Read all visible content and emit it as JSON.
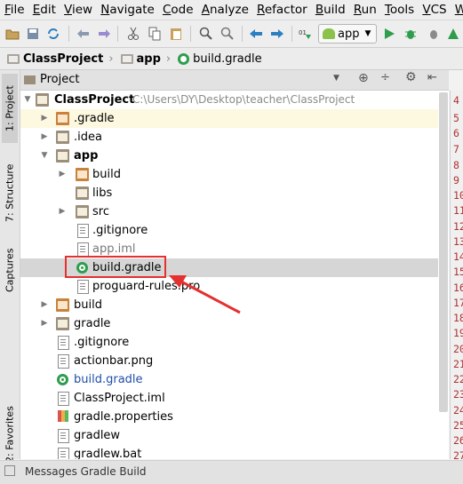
{
  "menu": [
    "File",
    "Edit",
    "View",
    "Navigate",
    "Code",
    "Analyze",
    "Refactor",
    "Build",
    "Run",
    "Tools",
    "VCS",
    "Windo"
  ],
  "toolbar": {
    "run_config": "app"
  },
  "breadcrumb": [
    "ClassProject",
    "app",
    "build.gradle"
  ],
  "panel": {
    "title": "Project"
  },
  "side_tabs": {
    "project": "1: Project",
    "structure": "7: Structure",
    "captures": "Captures",
    "favorites": "2: Favorites"
  },
  "tree": [
    {
      "label": "ClassProject",
      "path": "C:\\Users\\DY\\Desktop\\teacher\\ClassProject"
    },
    {
      "label": ".gradle"
    },
    {
      "label": ".idea"
    },
    {
      "label": "app"
    },
    {
      "label": "build"
    },
    {
      "label": "libs"
    },
    {
      "label": "src"
    },
    {
      "label": ".gitignore"
    },
    {
      "label": "app.iml"
    },
    {
      "label": "build.gradle"
    },
    {
      "label": "proguard-rules.pro"
    },
    {
      "label": "build"
    },
    {
      "label": "gradle"
    },
    {
      "label": ".gitignore"
    },
    {
      "label": "actionbar.png"
    },
    {
      "label": "build.gradle"
    },
    {
      "label": "ClassProject.iml"
    },
    {
      "label": "gradle.properties"
    },
    {
      "label": "gradlew"
    },
    {
      "label": "gradlew.bat"
    }
  ],
  "line_numbers": [
    "4",
    "5",
    "6",
    "7",
    "8",
    "9",
    "10",
    "11",
    "12",
    "13",
    "14",
    "15",
    "16",
    "17",
    "18",
    "19",
    "20",
    "21",
    "22",
    "23",
    "24",
    "25",
    "26",
    "27"
  ],
  "bottom": {
    "label": "Messages Gradle Build"
  },
  "colors": {
    "highlight": "#e53030",
    "accent_gradle": "#2e9d4e",
    "excluded_bg": "#fdf8e0",
    "selected_bg": "#d6d6d6"
  }
}
